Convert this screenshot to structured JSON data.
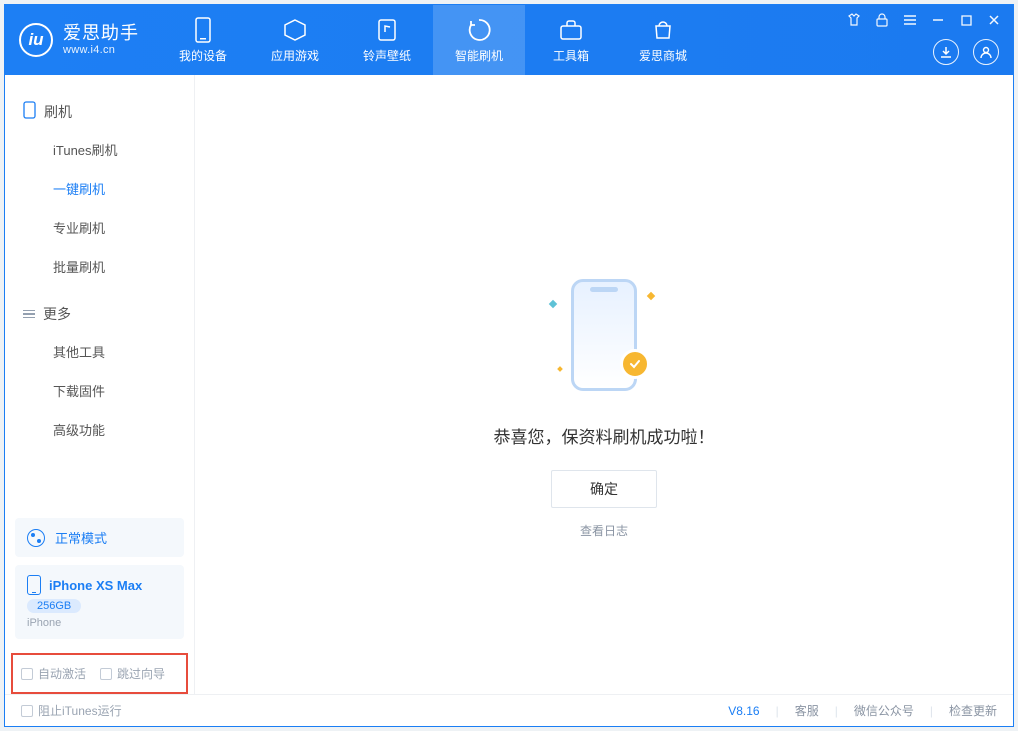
{
  "brand": {
    "title": "爱思助手",
    "subtitle": "www.i4.cn",
    "logo_letter": "iu"
  },
  "tabs": [
    {
      "label": "我的设备",
      "icon": "device-icon"
    },
    {
      "label": "应用游戏",
      "icon": "apps-icon"
    },
    {
      "label": "铃声壁纸",
      "icon": "ringtone-icon"
    },
    {
      "label": "智能刷机",
      "icon": "flash-icon",
      "active": true
    },
    {
      "label": "工具箱",
      "icon": "toolbox-icon"
    },
    {
      "label": "爱思商城",
      "icon": "store-icon"
    }
  ],
  "sidebar": {
    "sections": [
      {
        "title": "刷机",
        "icon": "phone-icon",
        "items": [
          "iTunes刷机",
          "一键刷机",
          "专业刷机",
          "批量刷机"
        ],
        "active_index": 1
      },
      {
        "title": "更多",
        "icon": "menu-icon",
        "items": [
          "其他工具",
          "下载固件",
          "高级功能"
        ],
        "active_index": -1
      }
    ],
    "mode": {
      "label": "正常模式"
    },
    "device": {
      "name": "iPhone XS Max",
      "storage": "256GB",
      "type": "iPhone"
    },
    "checks": {
      "auto_activate": "自动激活",
      "skip_guide": "跳过向导"
    }
  },
  "main": {
    "success_message": "恭喜您，保资料刷机成功啦！",
    "ok_button": "确定",
    "view_log": "查看日志"
  },
  "statusbar": {
    "block_itunes": "阻止iTunes运行",
    "version": "V8.16",
    "links": [
      "客服",
      "微信公众号",
      "检查更新"
    ]
  }
}
